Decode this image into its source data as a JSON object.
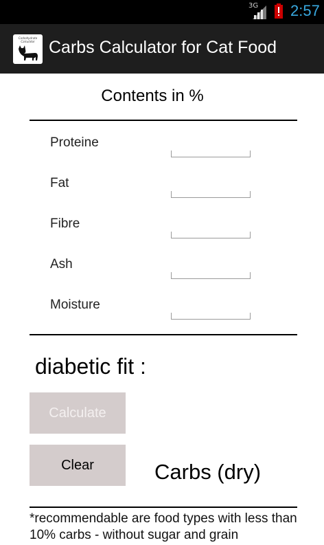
{
  "status_bar": {
    "network": "3G",
    "time": "2:57",
    "icons": [
      "signal-icon",
      "battery-alert-icon"
    ]
  },
  "action_bar": {
    "logo_text": "Carbohydrate Calculator",
    "logo_icon": "cat-icon",
    "title": "Carbs Calculator for Cat Food"
  },
  "form": {
    "section_title": "Contents in %",
    "fields": [
      {
        "label": "Proteine",
        "value": ""
      },
      {
        "label": "Fat",
        "value": ""
      },
      {
        "label": "Fibre",
        "value": ""
      },
      {
        "label": "Ash",
        "value": ""
      },
      {
        "label": "Moisture",
        "value": ""
      }
    ]
  },
  "result": {
    "diabetic_label": "diabetic fit :",
    "carbs_label": "Carbs (dry)"
  },
  "buttons": {
    "calculate": "Calculate",
    "clear": "Clear"
  },
  "footnote": "*recommendable are food types with less than 10% carbs - without sugar and grain",
  "colors": {
    "status_bar_bg": "#000000",
    "action_bar_bg": "#1e1e1e",
    "time_color": "#39a9e0",
    "button_bg": "#d4cccc",
    "disabled_text": "#f4f0f0"
  }
}
